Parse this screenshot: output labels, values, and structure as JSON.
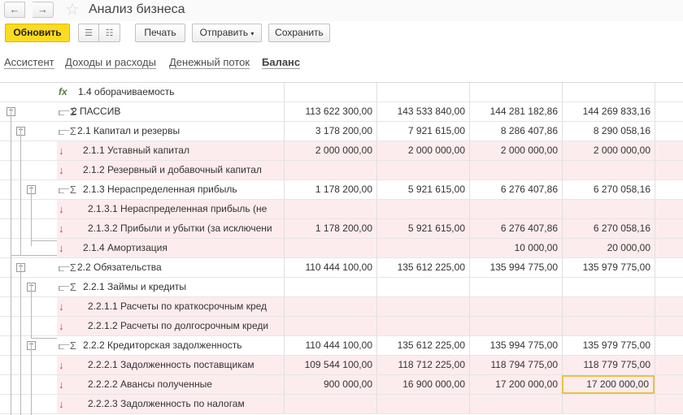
{
  "window": {
    "title": "Анализ бизнеса"
  },
  "toolbar": {
    "refresh_label": "Обновить",
    "print_label": "Печать",
    "send_label": "Отправить",
    "save_label": "Сохранить"
  },
  "tabs": [
    {
      "label": "Ассистент",
      "active": false
    },
    {
      "label": "Доходы и расходы",
      "active": false
    },
    {
      "label": "Денежный поток",
      "active": false
    },
    {
      "label": "Баланс",
      "active": true
    }
  ],
  "rows": [
    {
      "icon": "fx-icon",
      "label": "1.4   оборачиваемость",
      "values": [
        "",
        "",
        "",
        ""
      ],
      "pink": false
    },
    {
      "icon": "group-sum-icon",
      "label": "2   ПАССИВ",
      "values": [
        "113 622 300,00",
        "143 533 840,00",
        "144 281 182,86",
        "144 269 833,16"
      ],
      "pink": false
    },
    {
      "icon": "group-sum-icon",
      "label": "2.1   Капитал и резервы",
      "values": [
        "3 178 200,00",
        "7 921 615,00",
        "8 286 407,86",
        "8 290 058,16"
      ],
      "pink": false
    },
    {
      "icon": "arrow-down-icon",
      "label": "2.1.1   Уставный капитал",
      "values": [
        "2 000 000,00",
        "2 000 000,00",
        "2 000 000,00",
        "2 000 000,00"
      ],
      "pink": true
    },
    {
      "icon": "arrow-down-icon",
      "label": "2.1.2   Резервный и добавочный капитал",
      "values": [
        "",
        "",
        "",
        ""
      ],
      "pink": true
    },
    {
      "icon": "group-sum-icon",
      "label": "2.1.3   Нераспределенная прибыль",
      "values": [
        "1 178 200,00",
        "5 921 615,00",
        "6 276 407,86",
        "6 270 058,16"
      ],
      "pink": false
    },
    {
      "icon": "arrow-down-icon",
      "label": "2.1.3.1   Нераспределенная прибыль (не",
      "values": [
        "",
        "",
        "",
        ""
      ],
      "pink": true
    },
    {
      "icon": "arrow-down-icon",
      "label": "2.1.3.2   Прибыли и убытки (за исключени",
      "values": [
        "1 178 200,00",
        "5 921 615,00",
        "6 276 407,86",
        "6 270 058,16"
      ],
      "pink": true
    },
    {
      "icon": "arrow-down-icon",
      "label": "2.1.4   Амортизация",
      "values": [
        "",
        "",
        "10 000,00",
        "20 000,00"
      ],
      "pink": true
    },
    {
      "icon": "group-sum-icon",
      "label": "2.2   Обязательства",
      "values": [
        "110 444 100,00",
        "135 612 225,00",
        "135 994 775,00",
        "135 979 775,00"
      ],
      "pink": false
    },
    {
      "icon": "group-sum-icon",
      "label": "2.2.1   Займы и кредиты",
      "values": [
        "",
        "",
        "",
        ""
      ],
      "pink": false
    },
    {
      "icon": "arrow-down-icon",
      "label": "2.2.1.1   Расчеты по краткосрочным кред",
      "values": [
        "",
        "",
        "",
        ""
      ],
      "pink": true
    },
    {
      "icon": "arrow-down-icon",
      "label": "2.2.1.2   Расчеты по долгосрочным креди",
      "values": [
        "",
        "",
        "",
        ""
      ],
      "pink": true
    },
    {
      "icon": "group-sum-icon",
      "label": "2.2.2   Кредиторская задолженность",
      "values": [
        "110 444 100,00",
        "135 612 225,00",
        "135 994 775,00",
        "135 979 775,00"
      ],
      "pink": false
    },
    {
      "icon": "arrow-down-icon",
      "label": "2.2.2.1   Задолженность поставщикам",
      "values": [
        "109 544 100,00",
        "118 712 225,00",
        "118 794 775,00",
        "118 779 775,00"
      ],
      "pink": true
    },
    {
      "icon": "arrow-down-icon",
      "label": "2.2.2.2   Авансы полученные",
      "values": [
        "900 000,00",
        "16 900 000,00",
        "17 200 000,00",
        "17 200 000,00"
      ],
      "pink": true
    },
    {
      "icon": "arrow-down-icon",
      "label": "2.2.2.3   Задолженность по налогам",
      "values": [
        "",
        "",
        "",
        ""
      ],
      "pink": true
    }
  ]
}
